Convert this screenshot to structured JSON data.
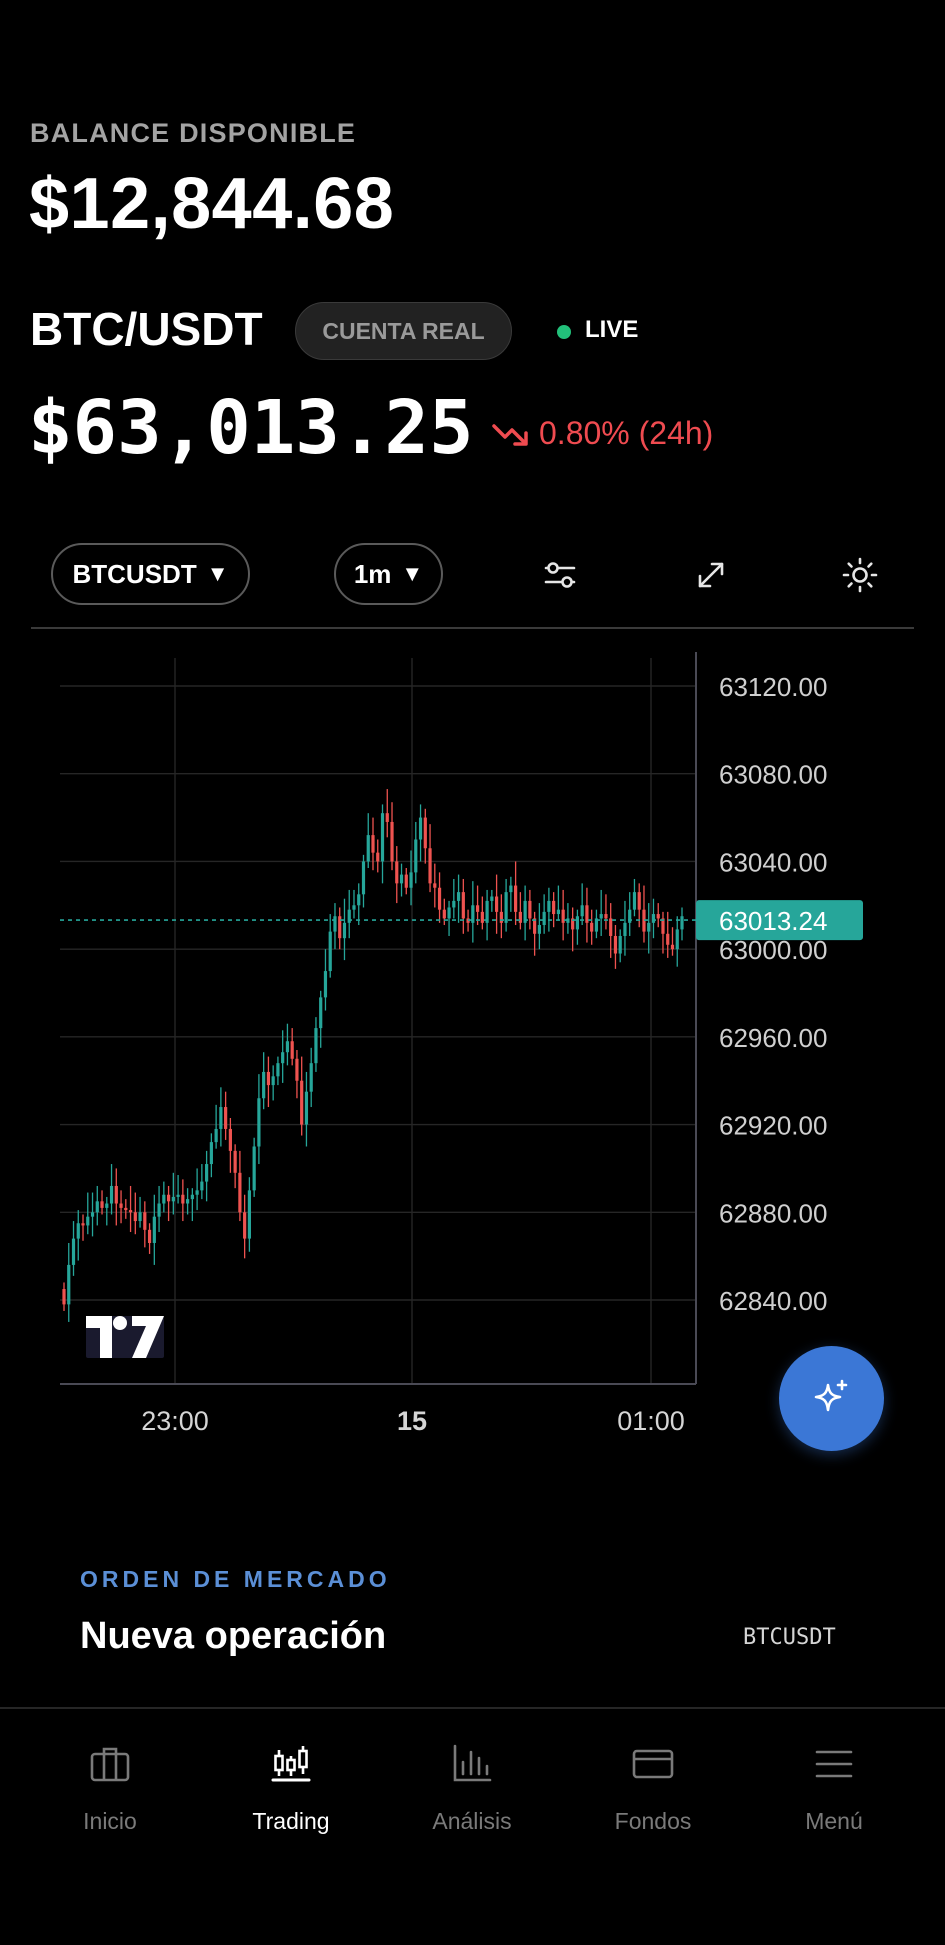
{
  "balance": {
    "label": "BALANCE DISPONIBLE",
    "value": "$12,844.68"
  },
  "ticker": {
    "pair": "BTC/USDT",
    "account_badge": "CUENTA REAL",
    "status": "LIVE",
    "price": "$63,013.25",
    "change": "0.80% (24h)",
    "change_direction": "down"
  },
  "toolbar": {
    "symbol": "BTCUSDT",
    "interval": "1m",
    "caret": "▼",
    "icons": [
      "indicators-sliders-icon",
      "fullscreen-expand-icon",
      "theme-sun-icon"
    ]
  },
  "chart_data": {
    "type": "candlestick",
    "symbol": "BTCUSDT",
    "interval": "1m",
    "y_ticks": [
      "63120.00",
      "63080.00",
      "63040.00",
      "63000.00",
      "62960.00",
      "62920.00",
      "62880.00",
      "62840.00"
    ],
    "ylim": [
      62800,
      63140
    ],
    "x_ticks": [
      {
        "label": "23:00",
        "bold": false
      },
      {
        "label": "15",
        "bold": true
      },
      {
        "label": "01:00",
        "bold": false
      }
    ],
    "current_price_label": "63013.24",
    "current_price": 63013.24,
    "up_color": "#26a69a",
    "down_color": "#ef5350",
    "start_price": 62845,
    "closes": [
      62838,
      62856,
      62868,
      62875,
      62874,
      62878,
      62880,
      62885,
      62882,
      62884,
      62892,
      62884,
      62882,
      62881,
      62880,
      62876,
      62880,
      62872,
      62866,
      62878,
      62884,
      62888,
      62885,
      62887,
      62888,
      62884,
      62886,
      62888,
      62890,
      62894,
      62902,
      62912,
      62918,
      62928,
      62918,
      62908,
      62898,
      62880,
      62868,
      62890,
      62910,
      62932,
      62944,
      62938,
      62942,
      62948,
      62953,
      62958,
      62950,
      62940,
      62920,
      62935,
      62948,
      62964,
      62978,
      62990,
      63008,
      63015,
      63005,
      63012,
      63018,
      63020,
      63025,
      63040,
      63052,
      63044,
      63040,
      63062,
      63058,
      63040,
      63030,
      63034,
      63028,
      63035,
      63050,
      63060,
      63046,
      63030,
      63028,
      63018,
      63014,
      63019,
      63022,
      63026,
      63014,
      63012,
      63020,
      63017,
      63012,
      63022,
      63024,
      63017,
      63012,
      63026,
      63029,
      63017,
      63012,
      63022,
      63014,
      63007,
      63011,
      63017,
      63022,
      63016,
      63018,
      63012,
      63014,
      63009,
      63015,
      63020,
      63012,
      63008,
      63014,
      63016,
      63014,
      63006,
      62998,
      63006,
      63012,
      63018,
      63026,
      63018,
      63008,
      63012,
      63016,
      63014,
      63007,
      63002,
      63000,
      63009,
      63015
    ]
  },
  "order": {
    "kicker": "ORDEN DE MERCADO",
    "title": "Nueva operación",
    "symbol": "BTCUSDT"
  },
  "nav": {
    "items": [
      {
        "label": "Inicio",
        "icon": "briefcase-icon",
        "active": false
      },
      {
        "label": "Trading",
        "icon": "candlestick-chart-icon",
        "active": true
      },
      {
        "label": "Análisis",
        "icon": "bar-chart-icon",
        "active": false
      },
      {
        "label": "Fondos",
        "icon": "credit-card-icon",
        "active": false
      },
      {
        "label": "Menú",
        "icon": "hamburger-menu-icon",
        "active": false
      }
    ]
  },
  "colors": {
    "background": "#000000",
    "live": "#22c07a",
    "negative": "#ef4b50",
    "accent": "#3b77d6",
    "kicker": "#5b8fd6",
    "price_line": "#26a69a"
  }
}
